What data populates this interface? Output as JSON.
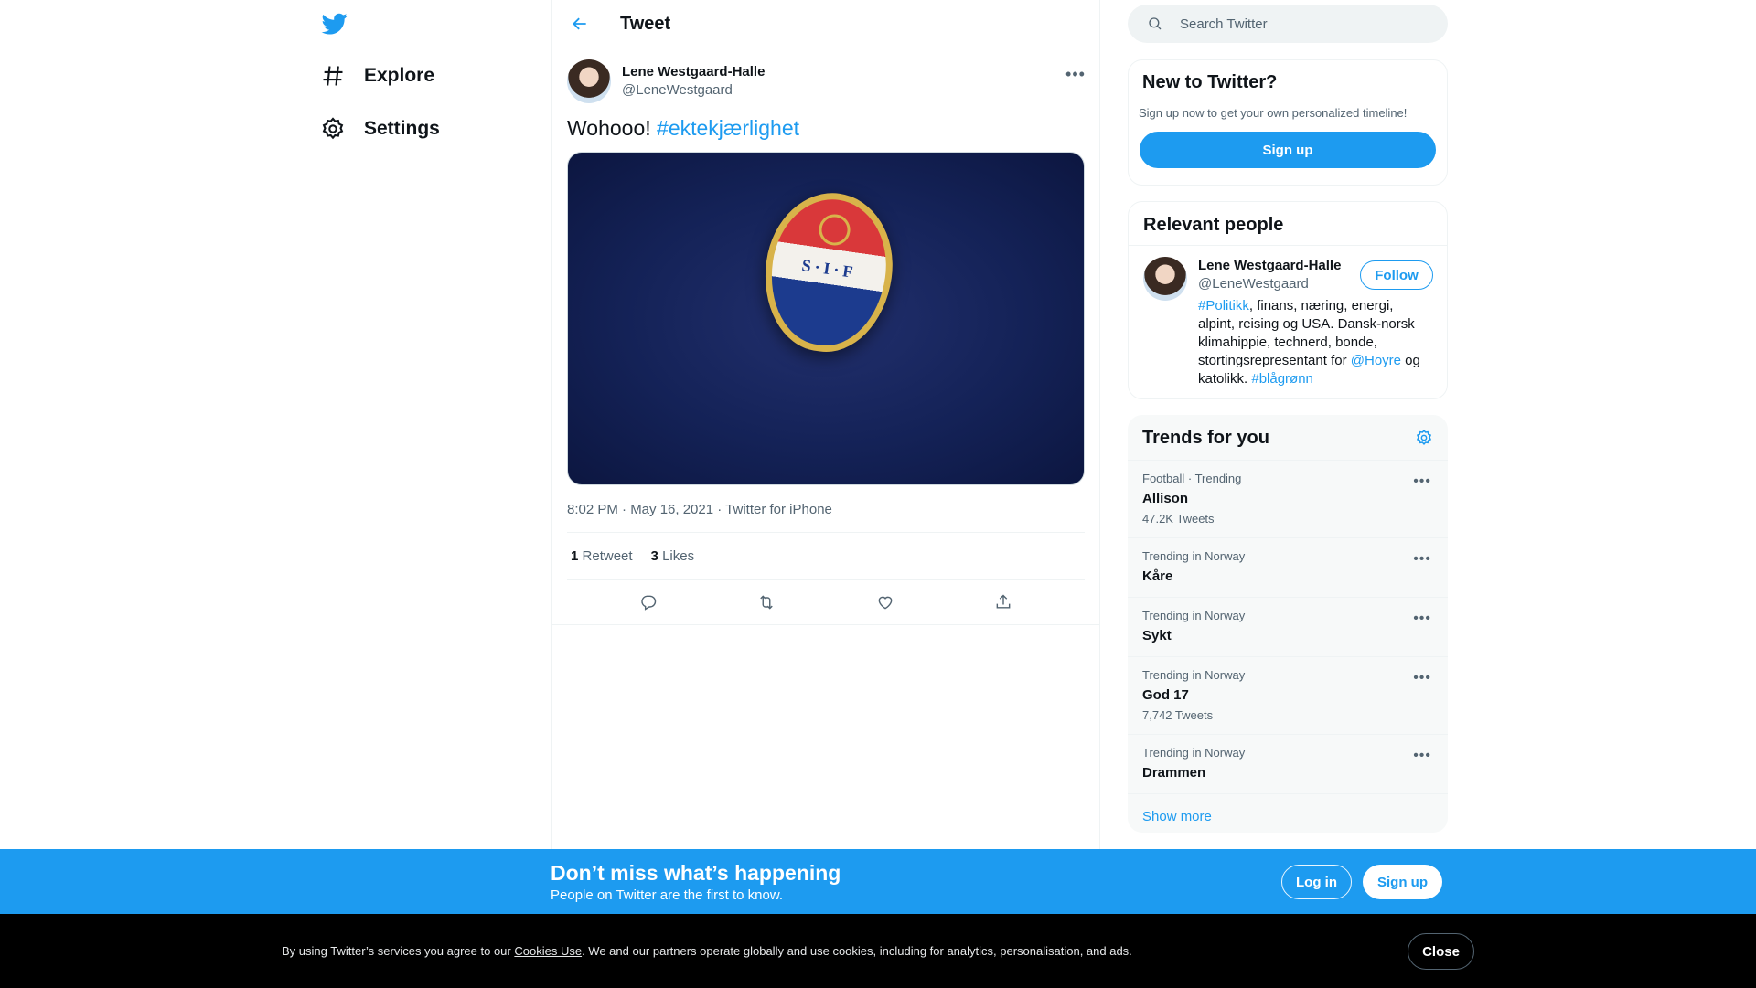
{
  "nav": {
    "logo_icon": "twitter-bird-icon",
    "items": [
      {
        "label": "Explore",
        "icon": "hashtag-icon"
      },
      {
        "label": "Settings",
        "icon": "gear-icon"
      }
    ]
  },
  "header": {
    "title": "Tweet",
    "back_icon": "arrow-left-icon"
  },
  "tweet": {
    "author_name": "Lene Westgaard-Halle",
    "author_handle": "@LeneWestgaard",
    "text_plain": "Wohooo! ",
    "hashtag": "#ektekjærlighet",
    "badge_text": "S·I·F",
    "timestamp": "8:02 PM · May 16, 2021",
    "source": "Twitter for iPhone",
    "meta_separator": " · ",
    "retweets_count": "1",
    "retweets_label": "Retweet",
    "likes_count": "3",
    "likes_label": "Likes"
  },
  "search": {
    "placeholder": "Search Twitter"
  },
  "signup_card": {
    "title": "New to Twitter?",
    "subtitle": "Sign up now to get your own personalized timeline!",
    "button": "Sign up"
  },
  "people_card": {
    "title": "Relevant people",
    "person": {
      "name": "Lene Westgaard-Halle",
      "handle": "@LeneWestgaard",
      "follow": "Follow",
      "bio_tag1": "#Politikk",
      "bio_text1": ", finans, næring, energi, alpint, reising og USA. Dansk-norsk klimahippie, technerd, bonde, stortingsrepresentant for ",
      "bio_mention": "@Hoyre",
      "bio_text2": " og katolikk. ",
      "bio_tag2": "#blågrønn"
    }
  },
  "trends_card": {
    "title": "Trends for you",
    "items": [
      {
        "context": "Football · Trending",
        "name": "Allison",
        "count": "47.2K Tweets"
      },
      {
        "context": "Trending in Norway",
        "name": "Kåre",
        "count": ""
      },
      {
        "context": "Trending in Norway",
        "name": "Sykt",
        "count": ""
      },
      {
        "context": "Trending in Norway",
        "name": "God 17",
        "count": "7,742 Tweets"
      },
      {
        "context": "Trending in Norway",
        "name": "Drammen",
        "count": ""
      }
    ],
    "show_more": "Show more"
  },
  "promo": {
    "title": "Don’t miss what’s happening",
    "subtitle": "People on Twitter are the first to know.",
    "login": "Log in",
    "signup": "Sign up"
  },
  "cookie": {
    "text_before": "By using Twitter’s services you agree to our ",
    "link": "Cookies Use",
    "text_after": ". We and our partners operate globally and use cookies, including for analytics, personalisation, and ads.",
    "close": "Close"
  },
  "colors": {
    "accent": "#1d9bf0",
    "text": "#0f1419",
    "muted": "#536471",
    "cookie_bg": "#000000"
  }
}
